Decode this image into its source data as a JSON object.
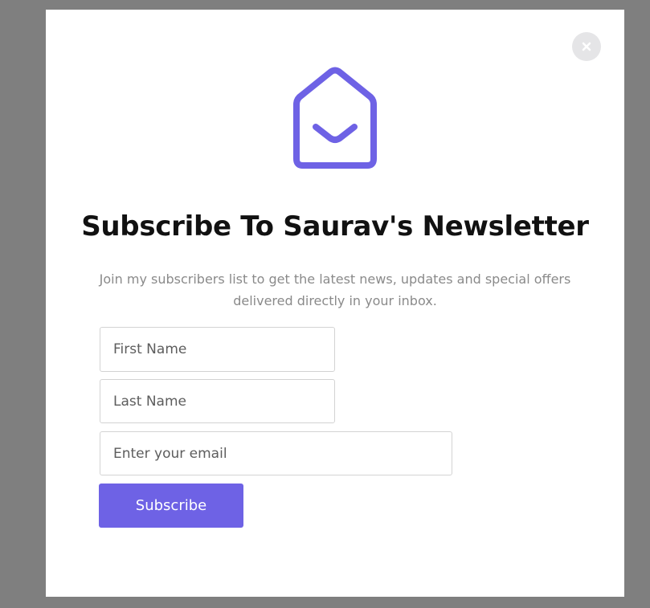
{
  "modal": {
    "title": "Subscribe To Saurav's Newsletter",
    "subtitle": "Join my subscribers list to get the latest news, updates and special offers delivered directly in your inbox.",
    "close_icon": "close-icon",
    "envelope_icon": "envelope-open-icon",
    "accent_color": "#6e62e5"
  },
  "form": {
    "first_name_placeholder": "First Name",
    "last_name_placeholder": "Last Name",
    "email_placeholder": "Enter your email",
    "submit_label": "Subscribe"
  }
}
